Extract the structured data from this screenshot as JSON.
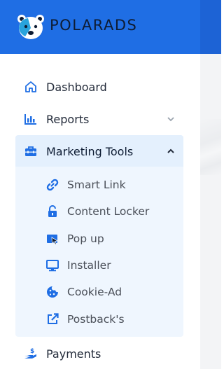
{
  "brand": {
    "name_part1": "POLAR",
    "name_part2": "ADS"
  },
  "colors": {
    "header_bg": "#1f6ee4",
    "accent": "#1f6ee4",
    "active_bg": "#e4f0fd",
    "submenu_bg": "#eff6fe",
    "text": "#232b3a"
  },
  "nav": {
    "dashboard": {
      "label": "Dashboard",
      "icon": "home-icon"
    },
    "reports": {
      "label": "Reports",
      "icon": "bar-chart-icon",
      "expanded": false
    },
    "marketing_tools": {
      "label": "Marketing Tools",
      "icon": "toolbox-icon",
      "expanded": true
    },
    "payments": {
      "label": "Payments",
      "icon": "hand-dollar-icon"
    }
  },
  "marketing_tools_items": [
    {
      "label": "Smart Link",
      "icon": "link-icon"
    },
    {
      "label": "Content Locker",
      "icon": "unlock-icon"
    },
    {
      "label": "Pop up",
      "icon": "popup-icon"
    },
    {
      "label": "Installer",
      "icon": "monitor-icon"
    },
    {
      "label": "Cookie-Ad",
      "icon": "cookie-icon"
    },
    {
      "label": "Postback's",
      "icon": "external-link-icon"
    }
  ]
}
